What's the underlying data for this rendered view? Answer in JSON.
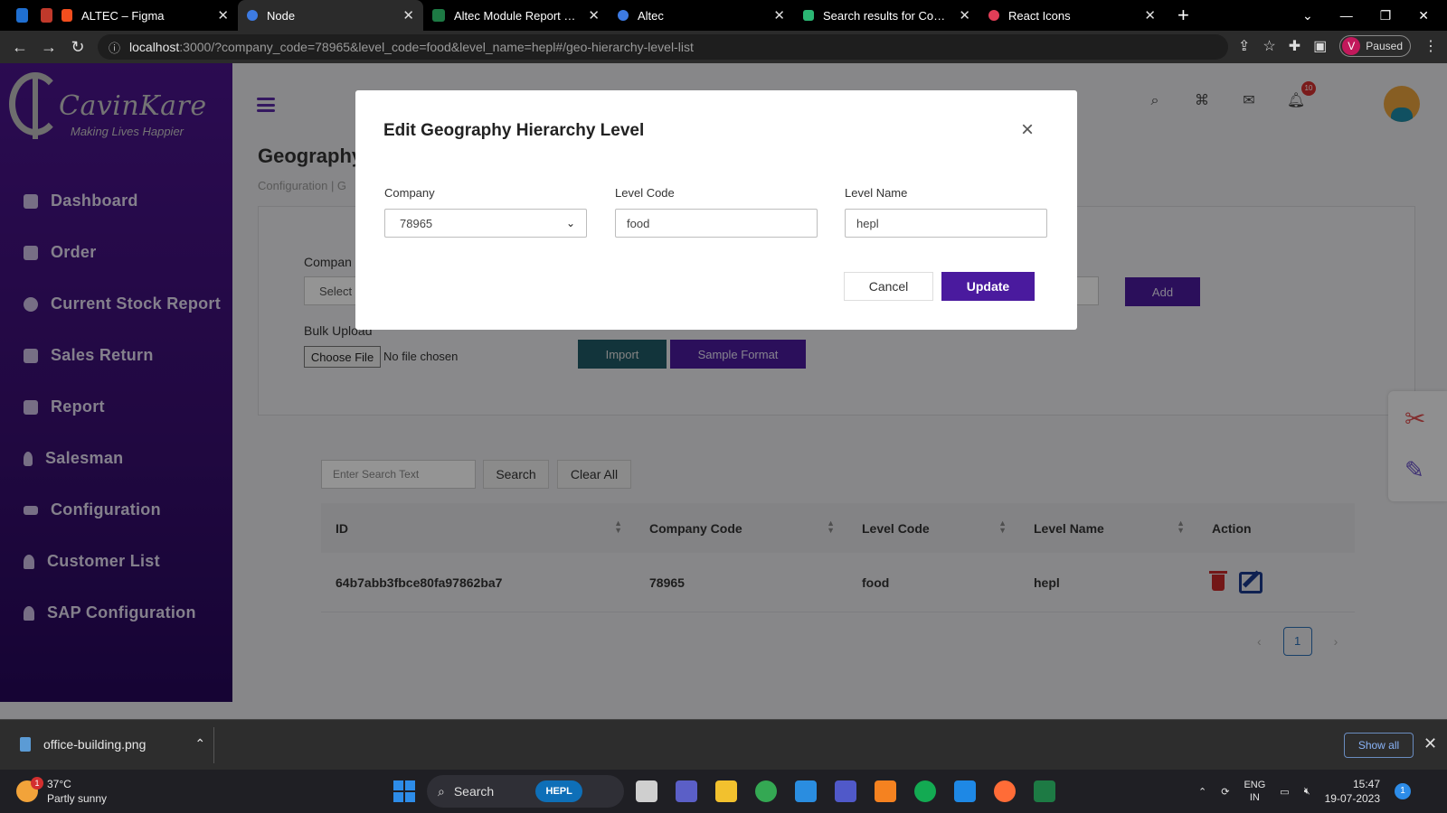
{
  "browser": {
    "tabs": [
      {
        "title": "ALTEC – Figma",
        "color": "#f24e1e",
        "active": false
      },
      {
        "title": "Node",
        "color": "#3d7be3",
        "active": true
      },
      {
        "title": "Altec Module Report - Pha",
        "color": "#1d7a44",
        "active": false
      },
      {
        "title": "Altec",
        "color": "#3d7be3",
        "active": false
      },
      {
        "title": "Search results for Compan",
        "color": "#2bb673",
        "active": false
      },
      {
        "title": "React Icons",
        "color": "#e23e57",
        "active": false
      }
    ],
    "url_host": "localhost",
    "url_rest": ":3000/?company_code=78965&level_code=food&level_name=hepl#/geo-hierarchy-level-list",
    "profile_initial": "V",
    "profile_status": "Paused"
  },
  "sidebar": {
    "brand_name": "CavinKare",
    "brand_tagline": "Making Lives Happier",
    "items": [
      {
        "label": "Dashboard",
        "icon": "chart-icon"
      },
      {
        "label": "Order",
        "icon": "cart-icon"
      },
      {
        "label": "Current Stock Report",
        "icon": "box-icon"
      },
      {
        "label": "Sales Return",
        "icon": "bag-icon"
      },
      {
        "label": "Report",
        "icon": "report-icon"
      },
      {
        "label": "Salesman",
        "icon": "salesman-icon"
      },
      {
        "label": "Configuration",
        "icon": "sliders-icon"
      },
      {
        "label": "Customer List",
        "icon": "user-icon"
      },
      {
        "label": "SAP Configuration",
        "icon": "user-icon"
      }
    ]
  },
  "page": {
    "title": "Geography",
    "breadcrumb": "Configuration | G",
    "notification_count": "10"
  },
  "form": {
    "company_label": "Compan",
    "company_select": "Select",
    "add_label": "Add",
    "bulk_label": "Bulk Upload",
    "choose_file": "Choose File",
    "no_file": "No file chosen",
    "import_label": "Import",
    "sample_label": "Sample Format"
  },
  "search": {
    "placeholder": "Enter Search Text",
    "search_label": "Search",
    "clear_label": "Clear All"
  },
  "table": {
    "headers": [
      "ID",
      "Company Code",
      "Level Code",
      "Level Name",
      "Action"
    ],
    "rows": [
      {
        "id": "64b7abb3fbce80fa97862ba7",
        "company_code": "78965",
        "level_code": "food",
        "level_name": "hepl"
      }
    ]
  },
  "pagination": {
    "current": "1",
    "prev": "‹",
    "next": "›"
  },
  "modal": {
    "title": "Edit Geography Hierarchy Level",
    "close": "×",
    "company_label": "Company",
    "company_value": "78965",
    "level_code_label": "Level Code",
    "level_code_value": "food",
    "level_name_label": "Level Name",
    "level_name_value": "hepl",
    "cancel_label": "Cancel",
    "update_label": "Update"
  },
  "downloads": {
    "file": "office-building.png",
    "show_all": "Show all"
  },
  "taskbar": {
    "temp": "37°C",
    "weather": "Partly sunny",
    "weather_badge": "1",
    "search": "Search",
    "hepl": "HEPL",
    "lang1": "ENG",
    "lang2": "IN",
    "time": "15:47",
    "date": "19-07-2023",
    "notifications": "1"
  },
  "colors": {
    "sidebar": "#4a148c",
    "primary_button": "#4a1a9e",
    "import_button": "#1f5a66"
  }
}
